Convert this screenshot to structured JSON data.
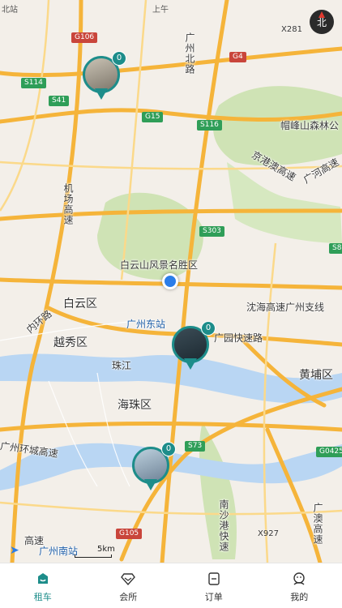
{
  "status_bar": {
    "left": "北站",
    "right": "上午"
  },
  "compass": {
    "label": "北"
  },
  "map": {
    "place_labels": {
      "baiyun_fengjing": "白云山风景名胜区",
      "baiyun_district": "白云区",
      "yuexiu": "越秀区",
      "haizhu": "海珠区",
      "huangpu": "黄埔区",
      "zhujiang": "珠江",
      "guangzhou_east": "广州东站",
      "guangzhou_south": "广州南站",
      "maofeng": "帽峰山森林公",
      "guangyuan_expy": "广园快速路",
      "shenhai_expy": "沈海高速广州支线",
      "jingangao": "京港澳高速",
      "guanghe": "广河高速",
      "inner_ring": "内环路",
      "airport_expy": "机场高速",
      "guangzhou_ring": "广州环城高速",
      "nansha_port": "南沙港快速",
      "guangao": "广澳高速",
      "gaosu": "高速",
      "gz_north": "广州北路",
      "jichang": "机场"
    },
    "road_tags": {
      "g106": "G106",
      "x281": "X281",
      "g4": "G4",
      "s114": "S114",
      "s41": "S41",
      "g15": "G15",
      "s116": "S116",
      "s303": "S303",
      "s8": "S8",
      "s73": "S73",
      "g0425": "G0425",
      "x927": "X927",
      "g105": "G105"
    },
    "scale_label": "5km",
    "markers": [
      {
        "count": "0"
      },
      {
        "count": "0"
      },
      {
        "count": "0"
      }
    ]
  },
  "tabbar": {
    "items": [
      {
        "label": "租车",
        "icon": "car-icon",
        "active": true
      },
      {
        "label": "会所",
        "icon": "diamond-icon",
        "active": false
      },
      {
        "label": "订单",
        "icon": "order-icon",
        "active": false
      },
      {
        "label": "我的",
        "icon": "profile-icon",
        "active": false
      }
    ]
  },
  "colors": {
    "accent": "#1d8d8a",
    "road_major": "#f5b43a",
    "green_area": "#cfe3b5",
    "water": "#b9d6f3"
  }
}
